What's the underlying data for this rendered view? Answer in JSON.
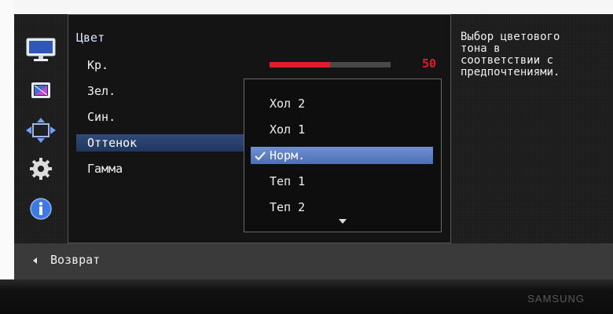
{
  "sidebar": {
    "icons": [
      {
        "name": "monitor-picture-icon"
      },
      {
        "name": "screen-adjust-icon"
      },
      {
        "name": "position-arrows-icon"
      },
      {
        "name": "gear-icon"
      },
      {
        "name": "info-icon"
      }
    ]
  },
  "menu": {
    "title": "Цвет",
    "items": [
      {
        "label": "Кр."
      },
      {
        "label": "Зел."
      },
      {
        "label": "Син."
      },
      {
        "label": "Оттенок"
      },
      {
        "label": "Гамма"
      }
    ],
    "selected_index": 3,
    "red_slider": {
      "value": "50",
      "fill_fraction": 0.5,
      "color": "#e21c2a"
    }
  },
  "dropdown": {
    "options": [
      {
        "label": "Хол 2"
      },
      {
        "label": "Хол 1"
      },
      {
        "label": "Норм."
      },
      {
        "label": "Теп 1"
      },
      {
        "label": "Теп 2"
      }
    ],
    "selected_index": 2,
    "more_indicator": "down-arrow-icon"
  },
  "help": {
    "text": "Выбор цветового\nтона в\nсоответствии с\nпредпочтениями."
  },
  "footer": {
    "back_label": "Возврат"
  },
  "brand": "SAMSUNG",
  "colors": {
    "selected_item": "#2f4a7a",
    "selected_option": "#5b7cc4",
    "accent_red": "#e21c2a"
  }
}
